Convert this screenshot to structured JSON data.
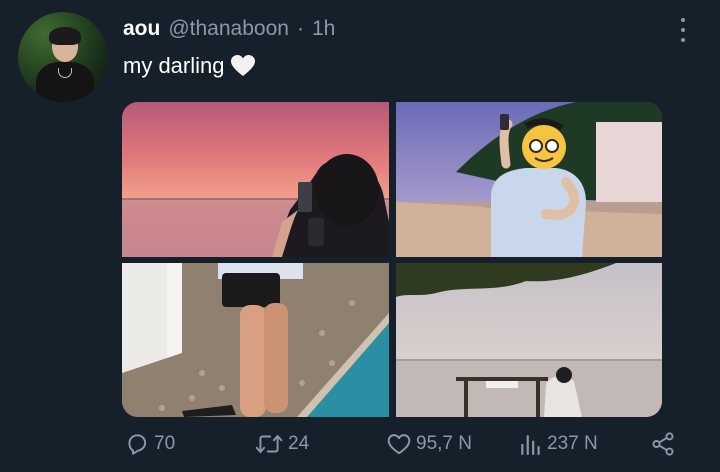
{
  "tweet": {
    "display_name": "aou",
    "handle": "@thanaboon",
    "separator": "·",
    "time": "1h",
    "text": "my darling",
    "text_emoji": "white-heart-emoji"
  },
  "media": {
    "photos": [
      {
        "label": "sunset-beach-phone-photo",
        "icon": "photo"
      },
      {
        "label": "beach-selfie-photo",
        "icon": "photo"
      },
      {
        "label": "legs-pool-photo",
        "icon": "photo"
      },
      {
        "label": "seaside-swing-photo",
        "icon": "photo"
      }
    ]
  },
  "actions": {
    "replies": "70",
    "retweets": "24",
    "likes": "95,7 N",
    "views": "237 N"
  },
  "colors": {
    "background": "#15202b",
    "secondary_text": "#8b98a5",
    "primary_text": "#ffffff"
  }
}
